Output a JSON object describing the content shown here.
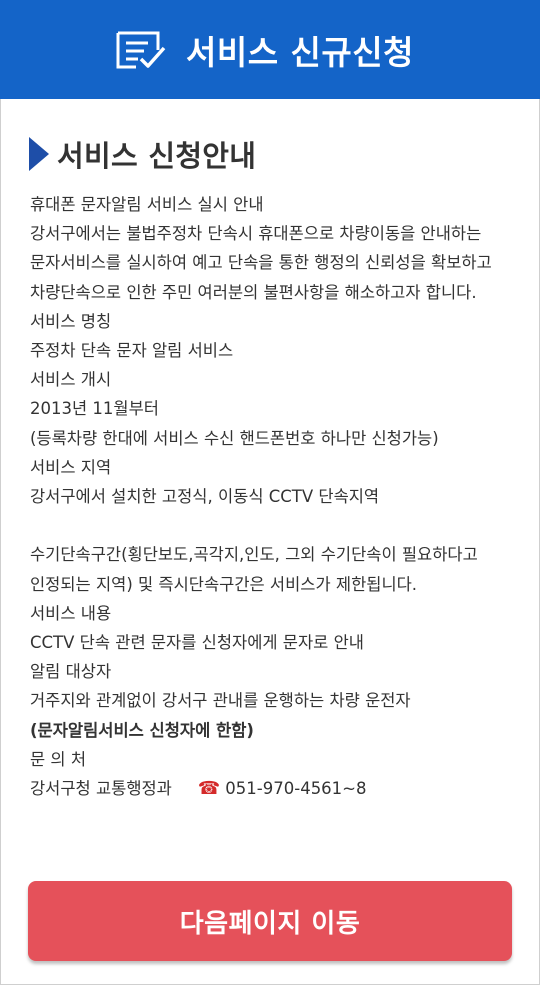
{
  "header": {
    "title": "서비스 신규신청",
    "icon": "form-check-icon"
  },
  "section": {
    "title": "서비스 신청안내",
    "icon": "triangle-arrow-icon"
  },
  "content": {
    "intro_title": "휴대폰 문자알림 서비스 실시 안내",
    "intro_text": "강서구에서는 불법주정차 단속시 휴대폰으로 차량이동을 안내하는 문자서비스를 실시하여 예고 단속을 통한 행정의 신뢰성을 확보하고 차량단속으로 인한 주민 여러분의 불편사항을 해소하고자 합니다.",
    "name_label": "서비스 명칭",
    "name_value": "주정차 단속 문자 알림 서비스",
    "start_label": "서비스 개시",
    "start_value": "2013년 11월부터",
    "start_note": "(등록차량 한대에 서비스 수신 핸드폰번호 하나만 신청가능)",
    "area_label": "서비스 지역",
    "area_value": "강서구에서 설치한 고정식, 이동식 CCTV 단속지역",
    "area_note": "수기단속구간(횡단보도,곡각지,인도, 그외 수기단속이 필요하다고 인정되는 지역) 및 즉시단속구간은 서비스가 제한됩니다.",
    "detail_label": "서비스 내용",
    "detail_value": "CCTV 단속 관련 문자를 신청자에게 문자로 안내",
    "target_label": "알림 대상자",
    "target_value": "거주지와 관계없이 강서구 관내를 운행하는 차량 운전자",
    "target_note": "(문자알림서비스 신청자에 한함)",
    "contact_label": "문 의 처",
    "contact_dept": "강서구청 교통행정과",
    "contact_phone": "051-970-4561~8",
    "phone_icon": "telephone-icon"
  },
  "buttons": {
    "next_label": "다음페이지 이동"
  },
  "colors": {
    "header_bg": "#1464c8",
    "section_arrow": "#1e4ea8",
    "button_bg": "#e5515a",
    "phone_icon": "#d42a2a"
  }
}
